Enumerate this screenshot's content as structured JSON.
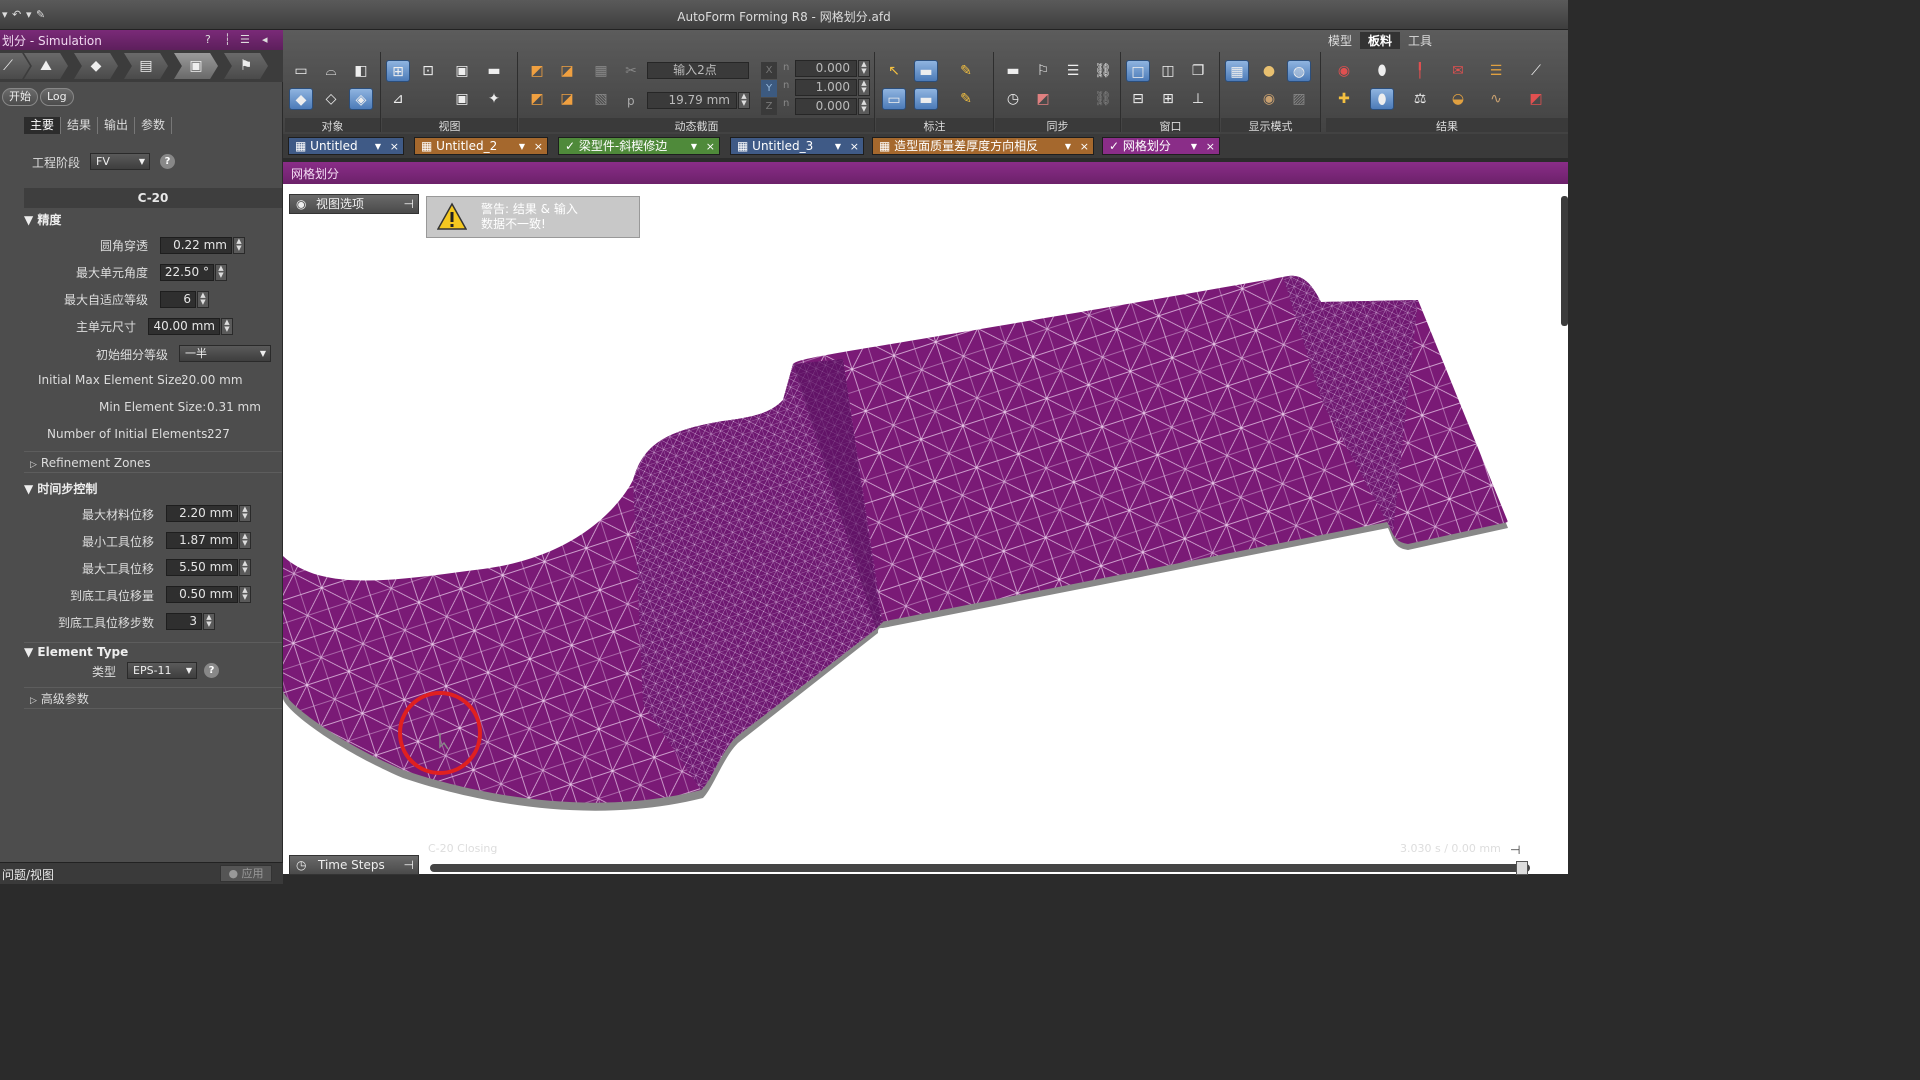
{
  "app": {
    "title": "AutoForm Forming R8 - 网格划分.afd",
    "panel_title": "划分 - Simulation"
  },
  "workflow": {
    "start_label": "开始",
    "log_label": "Log",
    "subtabs": [
      "主要",
      "结果",
      "输出",
      "参数"
    ]
  },
  "left": {
    "stage_label": "工程阶段",
    "stage_value": "FV",
    "section_id": "C-20",
    "precision": {
      "title": "精度",
      "rows": [
        {
          "label": "圆角穿透",
          "value": "0.22 mm"
        },
        {
          "label": "最大单元角度",
          "value": "22.50 °"
        },
        {
          "label": "最大自适应等级",
          "value": "6"
        },
        {
          "label": "主单元尺寸",
          "value": "40.00 mm"
        }
      ],
      "init_refine_label": "初始细分等级",
      "init_refine_value": "一半",
      "info": [
        {
          "label": "Initial Max Element Size:",
          "value": "20.00 mm"
        },
        {
          "label": "Min Element Size:",
          "value": "0.31 mm"
        },
        {
          "label": "Number of Initial Elements:",
          "value": "227"
        }
      ]
    },
    "refinement_zones": "Refinement Zones",
    "time_step": {
      "title": "时间步控制",
      "rows": [
        {
          "label": "最大材料位移",
          "value": "2.20 mm"
        },
        {
          "label": "最小工具位移",
          "value": "1.87 mm"
        },
        {
          "label": "最大工具位移",
          "value": "5.50 mm"
        },
        {
          "label": "到底工具位移量",
          "value": "0.50 mm"
        },
        {
          "label": "到底工具位移步数",
          "value": "3"
        }
      ]
    },
    "element_type": {
      "title": "Element Type",
      "type_label": "类型",
      "type_value": "EPS-11"
    },
    "advanced": "高级参数",
    "status_left": "问题/视图",
    "apply": "应用"
  },
  "ribbon": {
    "tabs": [
      "模型",
      "板料",
      "工具"
    ],
    "active_tab": "板料",
    "groups": [
      "对象",
      "视图",
      "动态截面",
      "标注",
      "同步",
      "窗口",
      "显示模式",
      "结果"
    ],
    "input_placeholder": "输入2点",
    "p_label": "p",
    "p_value": "19.79 mm",
    "n_values": [
      "0.000",
      "1.000",
      "0.000"
    ],
    "n_label": "n",
    "axes": [
      "X",
      "Y",
      "Z"
    ]
  },
  "doc_tabs": [
    {
      "label": "Untitled",
      "color": "#3f5a86"
    },
    {
      "label": "Untitled_2",
      "color": "#a5682d"
    },
    {
      "label": "梁型件-斜楔修边",
      "color": "#4f8a3a"
    },
    {
      "label": "Untitled_3",
      "color": "#3f5a86"
    },
    {
      "label": "造型面质量差厚度方向相反",
      "color": "#a5682d"
    },
    {
      "label": "网格划分",
      "color": "#8a2d88"
    }
  ],
  "doc_title": "网格划分",
  "viewport": {
    "view_options": "视图选项",
    "warning_line1": "警告: 结果 & 输入",
    "warning_line2": "数据不一致!",
    "time_steps": "Time Steps",
    "faint_left": "C-20 Closing",
    "faint_right": "3.030 s / 0.00 mm",
    "mesh_color": "#7a1a76"
  }
}
